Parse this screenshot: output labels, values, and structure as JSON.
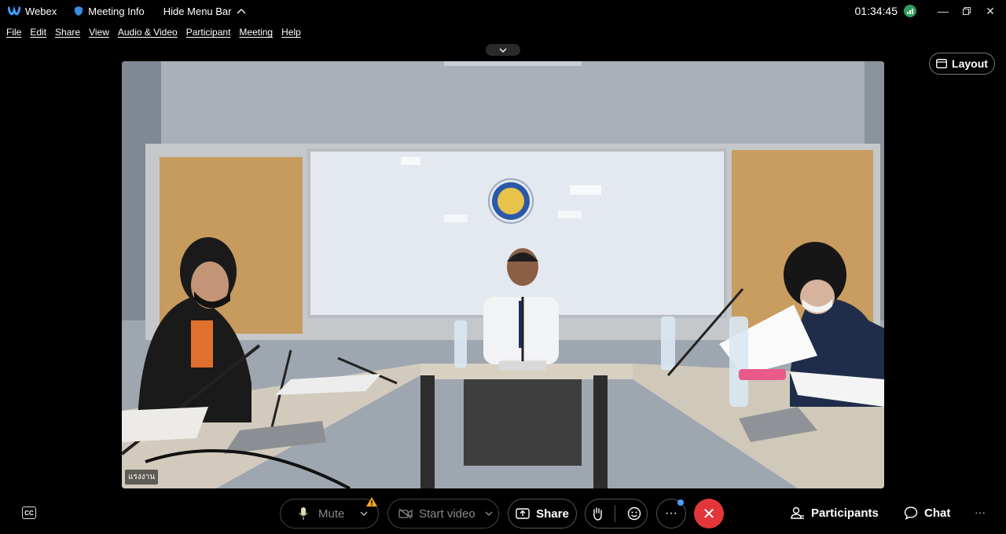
{
  "titlebar": {
    "app_name": "Webex",
    "meeting_info": "Meeting Info",
    "hide_menu": "Hide Menu Bar",
    "clock": "01:34:45"
  },
  "menu": [
    "File",
    "Edit",
    "Share",
    "View",
    "Audio & Video",
    "Participant",
    "Meeting",
    "Help"
  ],
  "layout_label": "Layout",
  "video": {
    "name_tag": "แรงงาน"
  },
  "controls": {
    "mute": "Mute",
    "start_video": "Start video",
    "share": "Share",
    "participants": "Participants",
    "chat": "Chat",
    "more": "···",
    "overflow": "···"
  },
  "colors": {
    "end_call": "#e2363b",
    "network_ok": "#2e9e5b",
    "notify_dot": "#4ba1ff",
    "warning": "#f5a623"
  }
}
